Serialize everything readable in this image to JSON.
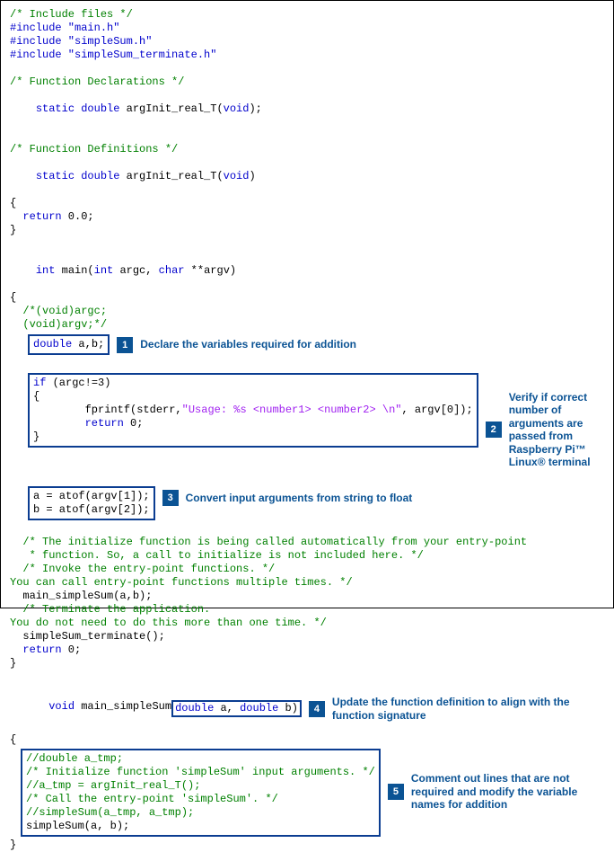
{
  "code": {
    "c1": "/* Include files */",
    "inc1": "#include \"main.h\"",
    "inc2": "#include \"simpleSum.h\"",
    "inc3": "#include \"simpleSum_terminate.h\"",
    "c2": "/* Function Declarations */",
    "decl1a": "static double",
    "decl1b": " argInit_real_T(",
    "decl1c": "void",
    "decl1d": ");",
    "c3": "/* Function Definitions */",
    "def1a": "static double",
    "def1b": " argInit_real_T(",
    "def1c": "void",
    "def1d": ")",
    "ob": "{",
    "cb": "}",
    "ret0a": "  return",
    "ret0b": " 0.0;",
    "main_a": "int",
    "main_b": " main(",
    "main_c": "int",
    "main_d": " argc, ",
    "main_e": "char",
    "main_f": " **argv)",
    "mc1": "  /*(void)argc;",
    "mc2": "  (void)argv;*/",
    "decl_ab": "double a,b;",
    "argc_if_a": "if",
    "argc_if_b": " (argc!=3)",
    "fprintf_a": "        fprintf(stderr,",
    "fprintf_b": "\"Usage: %s <number1> <number2> \\n\"",
    "fprintf_c": ", argv[0]);",
    "ret0c": "        return",
    "ret0d": " 0;",
    "atof1": "a = atof(argv[1]);",
    "atof2": "b = atof(argv[2]);",
    "c_init1": "  /* The initialize function is being called automatically from your entry-point",
    "c_init2": "   * function. So, a call to initialize is not included here. */",
    "c_invoke": "  /* Invoke the entry-point functions. */",
    "c_multi": "You can call entry-point functions multiple times. */",
    "call_ms": "  main_simpleSum(a,b);",
    "c_term": "  /* Terminate the application.",
    "c_once": "You do not need to do this more than one time. */",
    "call_term": "  simpleSum_terminate();",
    "ret0e": "  return",
    "ret0f": " 0;",
    "fn2a": "void",
    "fn2b": " main_simpleSum",
    "fn2c": "(double a, double b)",
    "b5_l1": "//double a_tmp;",
    "b5_l2": "/* Initialize function 'simpleSum' input arguments. */",
    "b5_l3": "//a_tmp = argInit_real_T();",
    "b5_l4": "/* Call the entry-point 'simpleSum'. */",
    "b5_l5": "//simpleSum(a_tmp, a_tmp);",
    "b5_l6": "simpleSum(a, b);"
  },
  "annotations": {
    "n1": "1",
    "t1": "Declare the variables required for addition",
    "n2": "2",
    "t2": "Verify if correct number of arguments are passed from Raspberry Pi™ Linux® terminal",
    "n3": "3",
    "t3": "Convert input arguments from string to float",
    "n4": "4",
    "t4": "Update the function definition to align with the function signature",
    "n5": "5",
    "t5": "Comment out lines that are not required and modify the variable names for addition"
  }
}
